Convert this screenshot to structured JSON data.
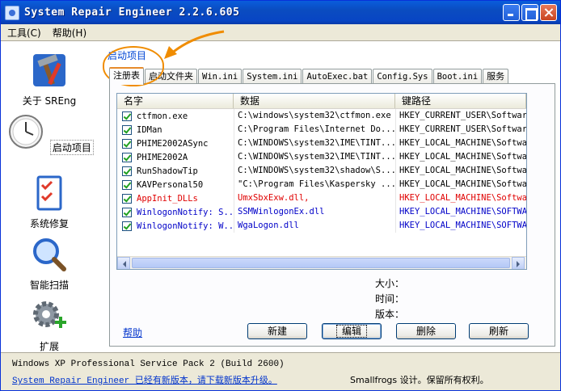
{
  "window": {
    "title": "System Repair Engineer 2.2.6.605"
  },
  "menu": [
    "工具(C)",
    "帮助(H)"
  ],
  "sidebar": [
    {
      "label": "关于 SREng",
      "icon": "hammer-wrench-icon"
    },
    {
      "label": "启动项目",
      "icon": "clock-icon",
      "active": true
    },
    {
      "label": "系统修复",
      "icon": "checklist-icon"
    },
    {
      "label": "智能扫描",
      "icon": "magnifier-icon"
    },
    {
      "label": "扩展",
      "icon": "gear-plus-icon"
    }
  ],
  "group_label": "启动项目",
  "tabs": [
    {
      "label": "注册表",
      "active": true
    },
    {
      "label": "启动文件夹"
    },
    {
      "label": "Win.ini"
    },
    {
      "label": "System.ini"
    },
    {
      "label": "AutoExec.bat"
    },
    {
      "label": "Config.Sys"
    },
    {
      "label": "Boot.ini"
    },
    {
      "label": "服务"
    }
  ],
  "list": {
    "columns": [
      "名字",
      "数据",
      "键路径"
    ],
    "rows": [
      {
        "name": "ctfmon.exe",
        "data": "C:\\windows\\system32\\ctfmon.exe",
        "path": "HKEY_CURRENT_USER\\Software",
        "color": "black"
      },
      {
        "name": "IDMan",
        "data": "C:\\Program Files\\Internet Do...",
        "path": "HKEY_CURRENT_USER\\Software",
        "color": "black"
      },
      {
        "name": "PHIME2002ASync",
        "data": "C:\\WINDOWS\\system32\\IME\\TINT...",
        "path": "HKEY_LOCAL_MACHINE\\Software",
        "color": "black"
      },
      {
        "name": "PHIME2002A",
        "data": "C:\\WINDOWS\\system32\\IME\\TINT...",
        "path": "HKEY_LOCAL_MACHINE\\Software",
        "color": "black"
      },
      {
        "name": "RunShadowTip",
        "data": "C:\\WINDOWS\\system32\\shadow\\S...",
        "path": "HKEY_LOCAL_MACHINE\\Software",
        "color": "black"
      },
      {
        "name": "KAVPersonal50",
        "data": "\"C:\\Program Files\\Kaspersky ...",
        "path": "HKEY_LOCAL_MACHINE\\Software",
        "color": "black"
      },
      {
        "name": "AppInit_DLLs",
        "data": "UmxSbxExw.dll,",
        "path": "HKEY_LOCAL_MACHINE\\Software",
        "color": "red"
      },
      {
        "name": "WinlogonNotify: S...",
        "data": "SSMWinlogonEx.dll",
        "path": "HKEY_LOCAL_MACHINE\\SOFTWARE",
        "color": "blue"
      },
      {
        "name": "WinlogonNotify: W...",
        "data": "WgaLogon.dll",
        "path": "HKEY_LOCAL_MACHINE\\SOFTWARE",
        "color": "blue"
      }
    ]
  },
  "info": {
    "size_label": "大小：",
    "time_label": "时间：",
    "version_label": "版本："
  },
  "help_link": "帮助",
  "buttons": {
    "new": "新建",
    "edit": "编辑",
    "delete": "删除",
    "refresh": "刷新"
  },
  "status": {
    "os": "Windows XP Professional Service Pack 2 (Build 2600)",
    "update_link": "System Repair Engineer 已经有新版本，请下载新版本升级。",
    "copyright": "Smallfrogs 设计。保留所有权利。"
  },
  "colors": {
    "accent": "#f08c00",
    "titlebar": "#0a4cc0",
    "red_row": "#e00000",
    "blue_row": "#0000c8"
  }
}
